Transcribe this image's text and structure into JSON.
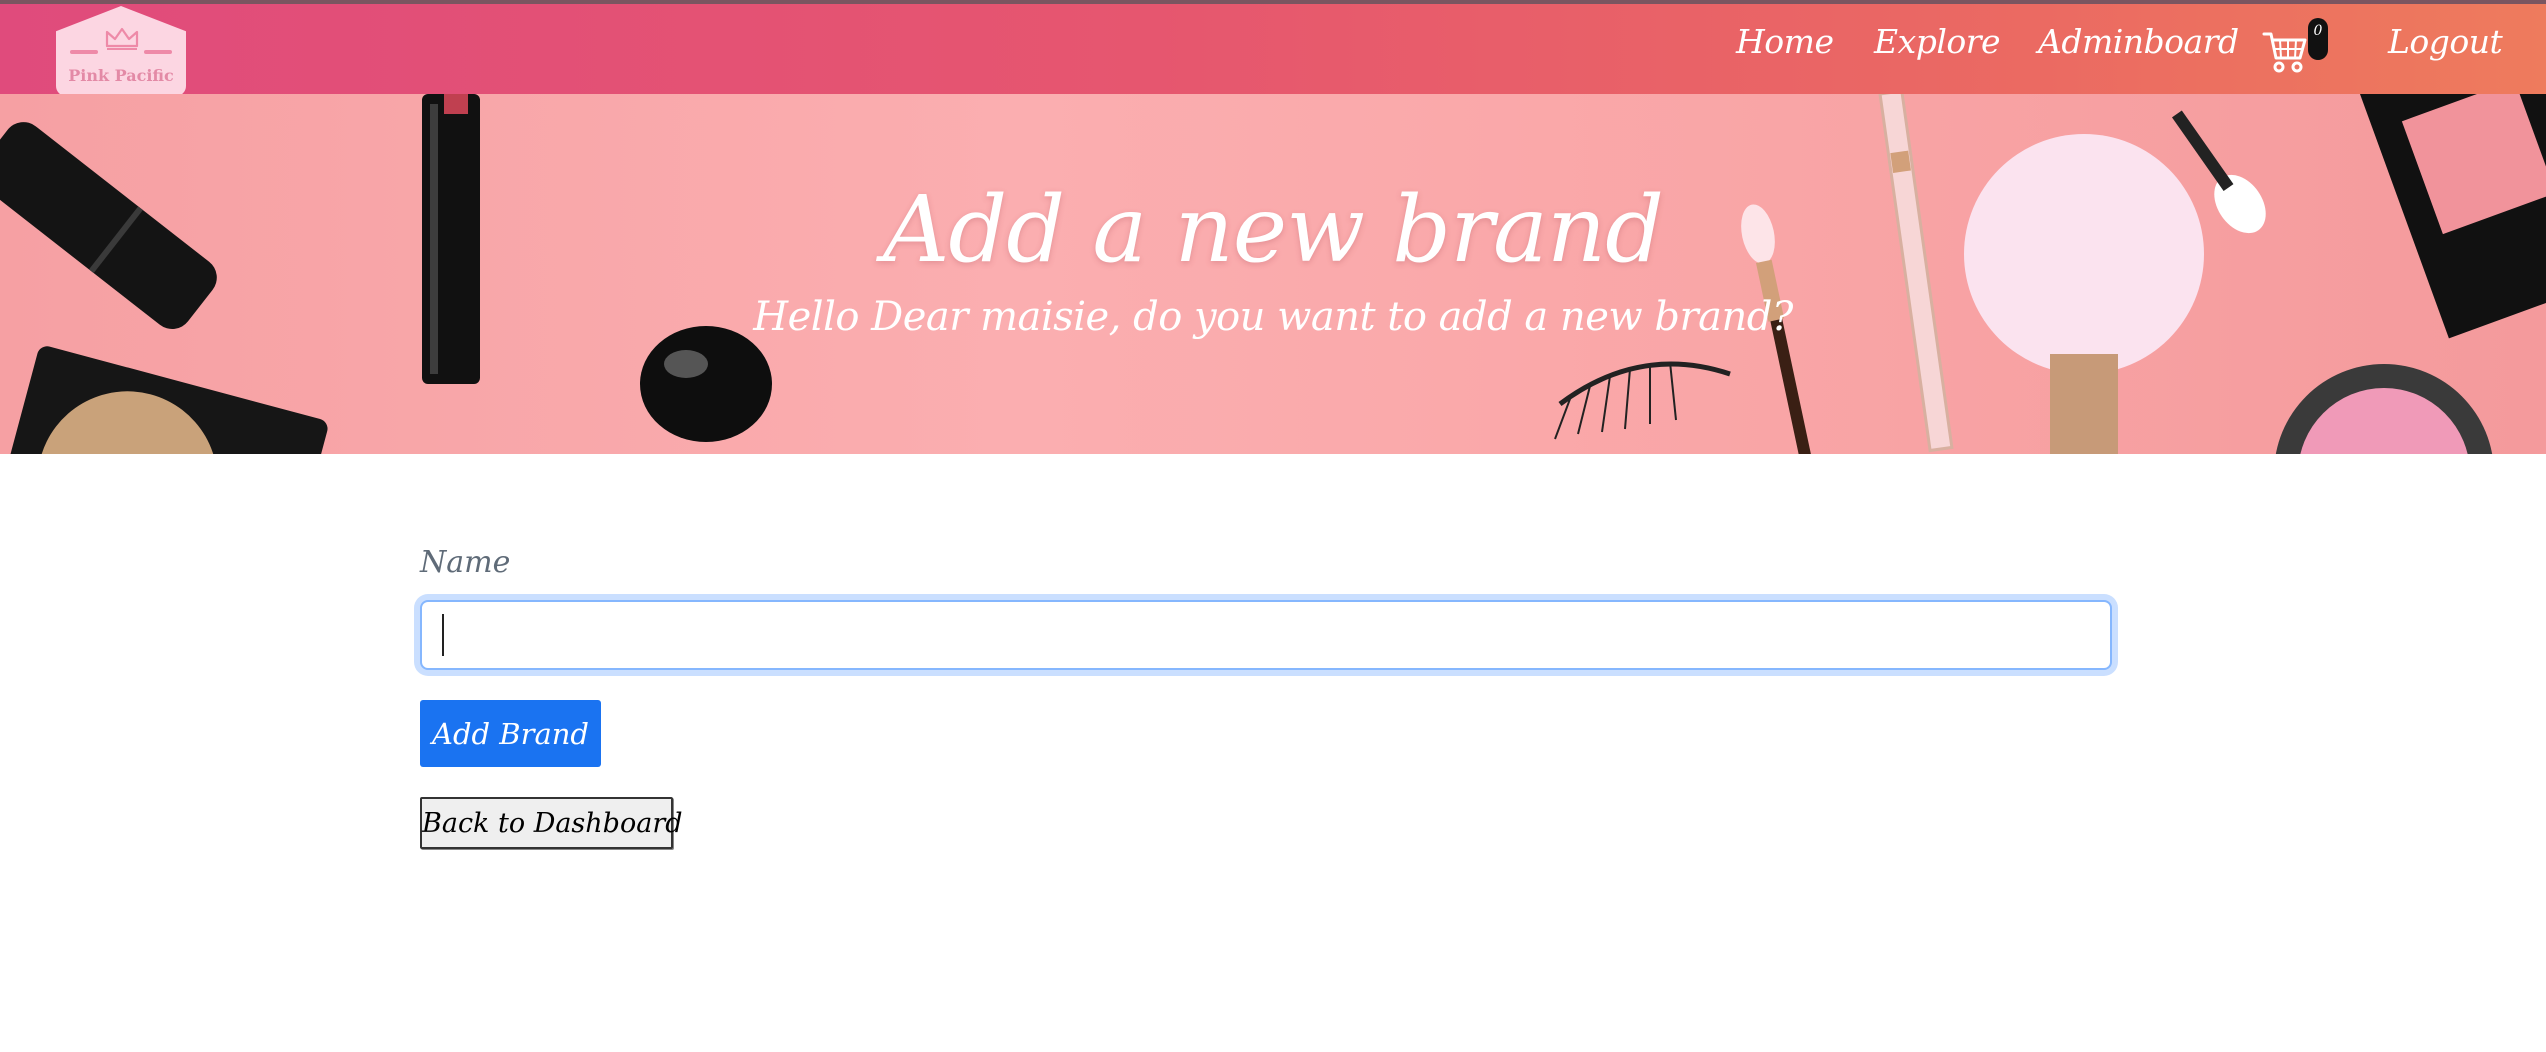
{
  "brand": {
    "logo_text": "Pink Pacific",
    "logo_icon": "crown-icon"
  },
  "nav": {
    "links": [
      "Home",
      "Explore",
      "Adminboard"
    ],
    "cart_icon": "cart-icon",
    "cart_count": "0",
    "logout_label": "Logout"
  },
  "hero": {
    "title": "Add a new brand",
    "subtitle": "Hello Dear maisie, do you want to add a new brand?"
  },
  "form": {
    "name_label": "Name",
    "name_value": "",
    "submit_label": "Add Brand",
    "back_label": "Back to Dashboard"
  },
  "colors": {
    "nav_gradient_start": "#e04b7c",
    "nav_gradient_end": "#ee7b5d",
    "hero_bg": "#fbaeb0",
    "primary_button": "#1a73f1",
    "focus_ring": "#86b7fe"
  }
}
